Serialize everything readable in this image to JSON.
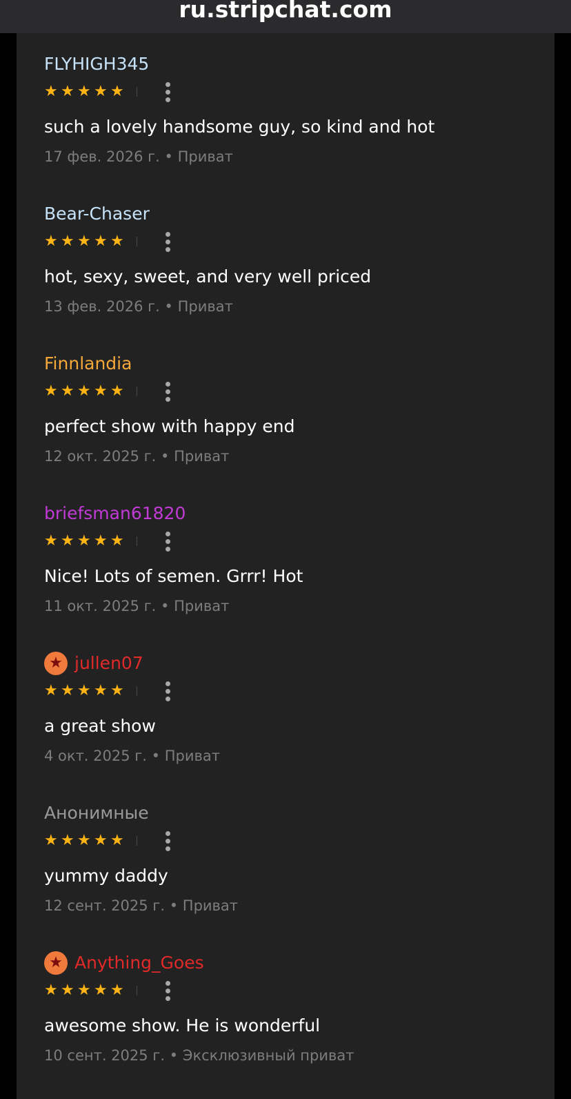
{
  "browser": {
    "url": "ru.stripchat.com"
  },
  "colors": {
    "star": "#fcb315",
    "comment_text": "#ffffff",
    "meta_text": "#7d7d7d",
    "panel_bg": "#222222",
    "badge_bg": "#f07a3c"
  },
  "reviews": [
    {
      "username": "FLYHIGH345",
      "username_color": "#c6e3fa",
      "badge": false,
      "rating": 5,
      "comment": "such a lovely handsome guy, so kind and hot",
      "date": "17 фев. 2026 г.",
      "separator": "•",
      "type": "Приват"
    },
    {
      "username": "Bear-Chaser",
      "username_color": "#c6e3fa",
      "badge": false,
      "rating": 5,
      "comment": "hot, sexy, sweet, and very well priced",
      "date": "13 фев. 2026 г.",
      "separator": "•",
      "type": "Приват"
    },
    {
      "username": "Finnlandia",
      "username_color": "#f5a83a",
      "badge": false,
      "rating": 5,
      "comment": "perfect show with happy end",
      "date": "12 окт. 2025 г.",
      "separator": "•",
      "type": "Приват"
    },
    {
      "username": "briefsman61820",
      "username_color": "#c23ad6",
      "badge": false,
      "rating": 5,
      "comment": "Nice! Lots of semen. Grrr! Hot",
      "date": "11 окт. 2025 г.",
      "separator": "•",
      "type": "Приват"
    },
    {
      "username": "jullen07",
      "username_color": "#e02a2a",
      "badge": true,
      "badge_icon": "star-badge-icon",
      "rating": 5,
      "comment": "a great show",
      "date": "4 окт. 2025 г.",
      "separator": "•",
      "type": "Приват"
    },
    {
      "username": "Анонимные",
      "username_color": "#9a9a9a",
      "badge": false,
      "rating": 5,
      "comment": "yummy daddy",
      "date": "12 сент. 2025 г.",
      "separator": "•",
      "type": "Приват"
    },
    {
      "username": "Anything_Goes",
      "username_color": "#e02a2a",
      "badge": true,
      "badge_icon": "star-badge-icon",
      "rating": 5,
      "comment": "awesome show. He is wonderful",
      "date": "10 сент. 2025 г.",
      "separator": "•",
      "type": "Эксклюзивный приват"
    }
  ]
}
